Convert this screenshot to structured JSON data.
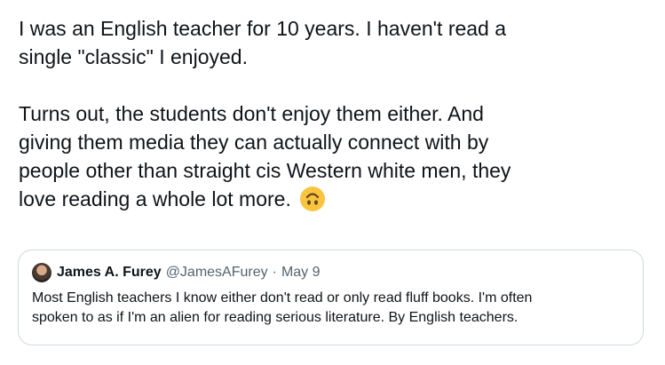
{
  "tweet": {
    "line1": "I was an English teacher for 10 years. I haven't read a",
    "line2": "single \"classic\" I enjoyed.",
    "line3": "Turns out, the students don't enjoy them either. And",
    "line4": "giving them media they can actually connect with by",
    "line5": "people other than straight cis Western white men, they",
    "line6": "love reading a whole lot more.",
    "emoji": "upside-down-face"
  },
  "quote": {
    "author_name": "James A. Furey",
    "author_handle": "@JamesAFurey",
    "separator": "·",
    "date": "May 9",
    "text_line1": "Most English teachers I know either don't read or only read fluff books. I'm often",
    "text_line2": "spoken to as if I'm an alien for reading serious literature. By English teachers."
  },
  "colors": {
    "text": "#0f1419",
    "secondary": "#536471",
    "border": "#cfd9de",
    "emoji": "#f9c540"
  }
}
